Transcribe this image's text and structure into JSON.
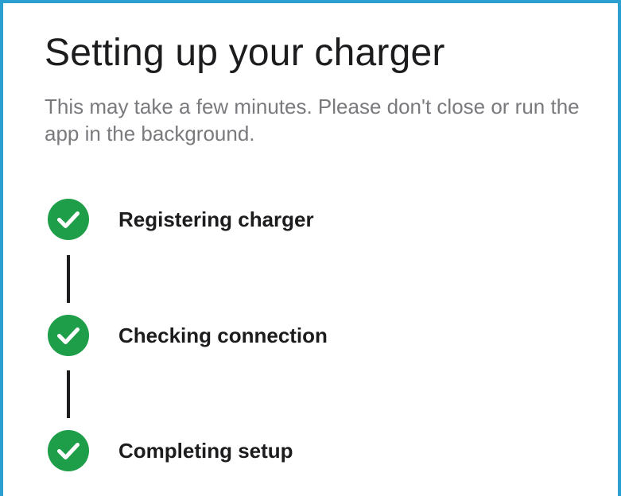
{
  "screen": {
    "title": "Setting up your charger",
    "subtitle": "This may take a few minutes. Please don't close or run the app in the background."
  },
  "steps": [
    {
      "label": "Registering charger",
      "status": "complete",
      "icon": "check-circle-icon"
    },
    {
      "label": "Checking connection",
      "status": "complete",
      "icon": "check-circle-icon"
    },
    {
      "label": "Completing setup",
      "status": "complete",
      "icon": "check-circle-icon"
    }
  ],
  "colors": {
    "frame_border": "#2b9fd0",
    "success_green": "#1f9e4a",
    "text_primary": "#1c1c1e",
    "text_secondary": "#7a7a7e"
  }
}
